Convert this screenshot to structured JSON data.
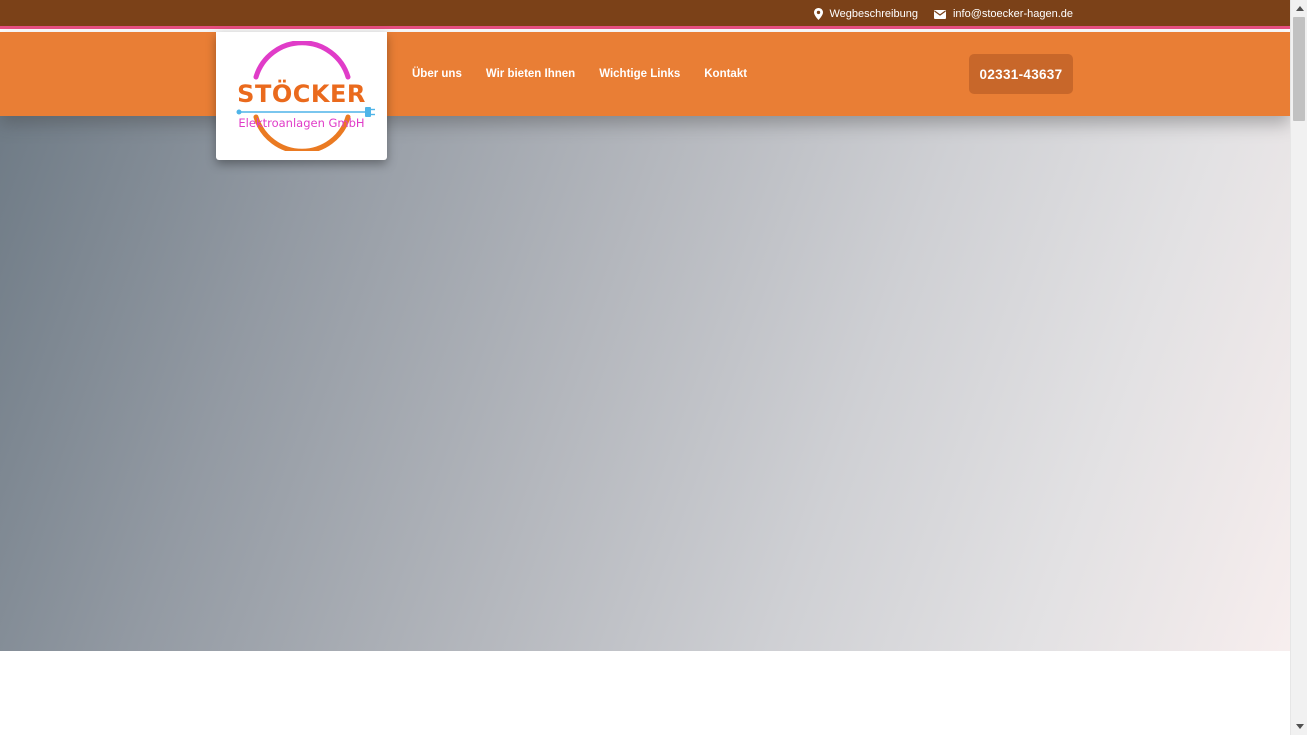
{
  "topbar": {
    "directions_label": "Wegbeschreibung",
    "email_label": "info@stoecker-hagen.de",
    "icons": {
      "directions": "map-pin-icon",
      "email": "envelope-icon"
    }
  },
  "logo": {
    "title": "STÖCKER",
    "subtitle": "Elektroanlagen GmbH"
  },
  "nav": {
    "items": [
      {
        "label": "Über uns"
      },
      {
        "label": "Wir bieten Ihnen"
      },
      {
        "label": "Wichtige Links"
      },
      {
        "label": "Kontakt"
      }
    ]
  },
  "phone": {
    "label": "02331-43637"
  },
  "colors": {
    "topbar": "#7b4118",
    "accent_line": "#e94f82",
    "navbar": "#e97e35",
    "phone_button": "#c8672a",
    "logo_orange": "#ea6a1d",
    "logo_magenta": "#e03cc8",
    "logo_blue": "#4fb4e8"
  }
}
